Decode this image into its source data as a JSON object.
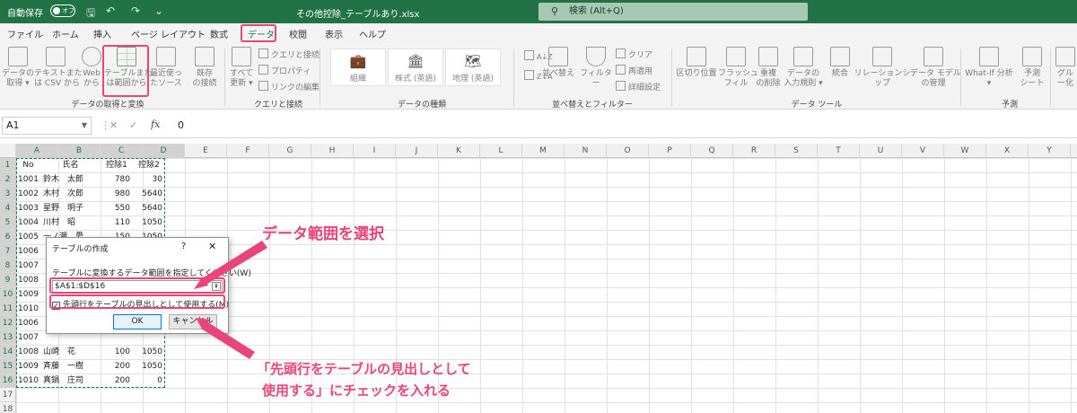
{
  "titlebar": {
    "autosave_label": "自動保存",
    "autosave_state": "オフ",
    "filename": "その他控除_テーブルあり.xlsx",
    "search_placeholder": "検索 (Alt+Q)"
  },
  "tabs": [
    "ファイル",
    "ホーム",
    "挿入",
    "ページ レイアウト",
    "数式",
    "データ",
    "校閲",
    "表示",
    "ヘルプ"
  ],
  "active_tab": "データ",
  "ribbon": {
    "get_transform": {
      "label": "データの取得と変換",
      "buttons": [
        "データの\n取得 ▾",
        "テキストまた\nは CSV から",
        "Web\nから",
        "テーブルまた\nは範囲から",
        "最近使っ\nたソース",
        "既存\nの接続"
      ]
    },
    "queries": {
      "label": "クエリと接続",
      "refresh_all": "すべて\n更新 ▾",
      "items": [
        "クエリと接続",
        "プロパティ",
        "リンクの編集"
      ]
    },
    "data_types": {
      "label": "データの種類",
      "items": [
        "組織",
        "株式 (英語)",
        "地理 (英語)"
      ]
    },
    "sort_filter": {
      "label": "並べ替えとフィルター",
      "sort_az": "A↓Z",
      "sort_za": "Z↓A",
      "sort": "並べ替え",
      "filter": "フィルター",
      "items": [
        "クリア",
        "再適用",
        "詳細設定"
      ]
    },
    "data_tools": {
      "label": "データ ツール",
      "buttons": [
        "区切り位置",
        "フラッシュ\nフィル",
        "重複\nの削除",
        "データの\n入力規則 ▾",
        "統合",
        "リレーションシップ",
        "データ モデル\nの管理"
      ]
    },
    "forecast": {
      "label": "予測",
      "buttons": [
        "What-If 分析\n▾",
        "予測\nシート"
      ]
    },
    "outline": {
      "buttons": [
        "グル\nー化"
      ]
    }
  },
  "formula_bar": {
    "name_box": "A1",
    "cancel": "✕",
    "enter": "✓",
    "fx": "fx",
    "value": "0"
  },
  "grid": {
    "columns": [
      "A",
      "B",
      "C",
      "D",
      "E",
      "F",
      "G",
      "H",
      "I",
      "J",
      "K",
      "L",
      "M",
      "N",
      "O",
      "P",
      "Q",
      "R",
      "S",
      "T",
      "U",
      "V",
      "W",
      "X",
      "Y"
    ],
    "rows": [
      "1",
      "2",
      "3",
      "4",
      "5",
      "6",
      "7",
      "8",
      "9",
      "10",
      "11",
      "12",
      "13",
      "14",
      "15",
      "16",
      "17",
      "18"
    ],
    "header_row": [
      "No",
      "氏名",
      "控除1",
      "控除2"
    ],
    "data": [
      [
        "1001",
        "鈴木　太郎",
        "780",
        "30"
      ],
      [
        "1002",
        "木村　次郎",
        "980",
        "5640"
      ],
      [
        "1003",
        "星野　明子",
        "550",
        "5640"
      ],
      [
        "1004",
        "川村　昭",
        "110",
        "1050"
      ],
      [
        "1005",
        "一ノ瀬　愛",
        "150",
        "1050"
      ],
      [
        "1006",
        "",
        "",
        ""
      ],
      [
        "1007",
        "",
        "",
        ""
      ],
      [
        "1008",
        "",
        "",
        ""
      ],
      [
        "1009",
        "",
        "",
        ""
      ],
      [
        "1010",
        "",
        "",
        ""
      ],
      [
        "1006",
        "",
        "",
        ""
      ],
      [
        "1007",
        "",
        "",
        ""
      ],
      [
        "1008",
        "山崎　花",
        "100",
        "1050"
      ],
      [
        "1009",
        "斉藤　一樹",
        "200",
        "1050"
      ],
      [
        "1010",
        "真鍋　庄司",
        "200",
        "0"
      ]
    ]
  },
  "dialog": {
    "title": "テーブルの作成",
    "help": "?",
    "close": "✕",
    "label": "テーブルに変換するデータ範囲を指定してください(W)",
    "range_value": "$A$1:$D$16",
    "range_pick": "⇞",
    "checkbox_label": "先頭行をテーブルの見出しとして使用する(M)",
    "checkbox_mark": "✓",
    "ok": "OK",
    "cancel": "キャンセル"
  },
  "annotations": {
    "callout_1": "データ範囲を選択",
    "callout_2_line1": "「先頭行をテーブルの見出しとして",
    "callout_2_line2": "使用する」にチェックを入れる",
    "accent": "#e8457a"
  },
  "colors": {
    "excel_green": "#217346",
    "ribbon_bg": "#f3f3f3"
  }
}
